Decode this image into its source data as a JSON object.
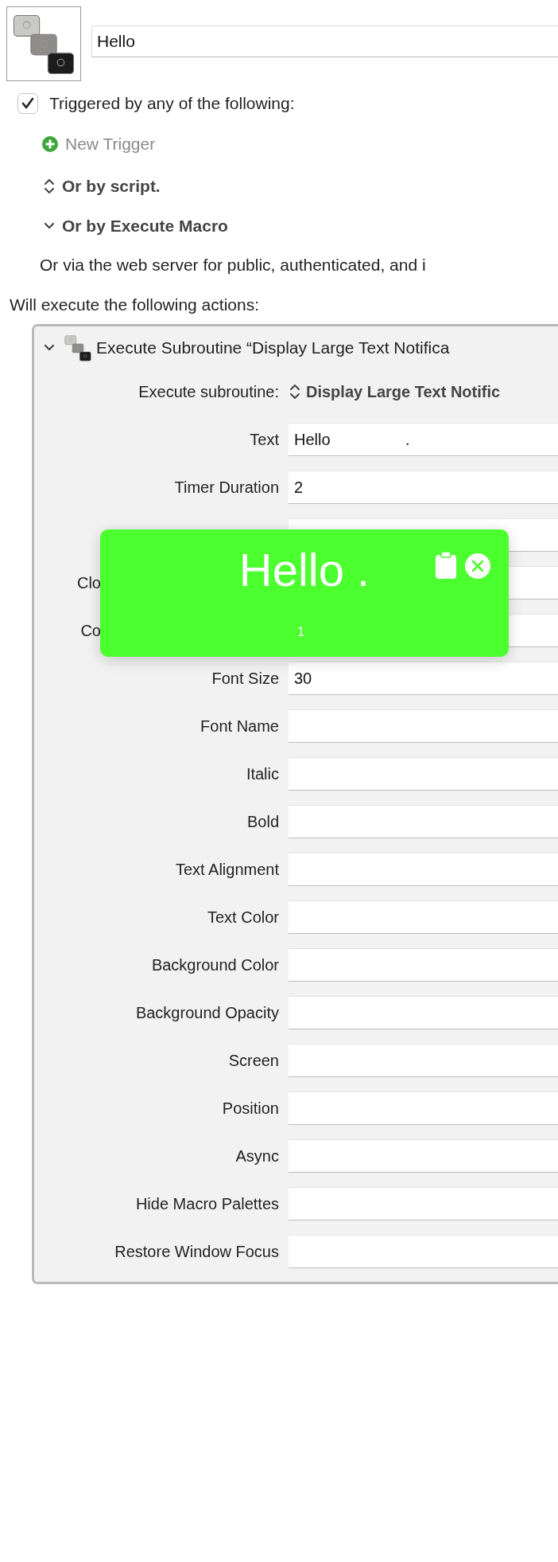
{
  "macro": {
    "name": "Hello"
  },
  "trigger": {
    "label": "Triggered by any of the following:",
    "checked": true,
    "new_trigger": "New Trigger"
  },
  "trigger_options": [
    {
      "kind": "popup",
      "label": "Or by script."
    },
    {
      "kind": "disclosure",
      "label": "Or by Execute Macro",
      "expanded": true
    }
  ],
  "web_note": "Or via the web server for public, authenticated, and i",
  "actions_heading": "Will execute the following actions:",
  "action": {
    "title": "Execute Subroutine “Display Large Text Notifica",
    "expanded": true,
    "subroutine_label": "Execute subroutine:",
    "subroutine": "Display Large Text Notific",
    "parameters": [
      {
        "kind": "labeled",
        "label": "Text",
        "value": "Hello                 ."
      },
      {
        "kind": "labeled",
        "label": "Timer Duration",
        "value": "2"
      },
      {
        "kind": "covered"
      },
      {
        "kind": "cut",
        "label": "Clo"
      },
      {
        "kind": "cut",
        "label": "Co"
      },
      {
        "kind": "labeled",
        "label": "Font Size",
        "value": "30"
      },
      {
        "kind": "labeled",
        "label": "Font Name"
      },
      {
        "kind": "labeled",
        "label": "Italic"
      },
      {
        "kind": "labeled",
        "label": "Bold"
      },
      {
        "kind": "labeled",
        "label": "Text Alignment"
      },
      {
        "kind": "labeled",
        "label": "Text Color"
      },
      {
        "kind": "labeled",
        "label": "Background Color"
      },
      {
        "kind": "labeled",
        "label": "Background Opacity"
      },
      {
        "kind": "labeled",
        "label": "Screen"
      },
      {
        "kind": "labeled",
        "label": "Position"
      },
      {
        "kind": "labeled",
        "label": "Async"
      },
      {
        "kind": "labeled",
        "label": "Hide Macro Palettes"
      },
      {
        "kind": "labeled",
        "label": "Restore Window Focus"
      }
    ]
  },
  "notification": {
    "text": "Hello .",
    "count": "1"
  }
}
